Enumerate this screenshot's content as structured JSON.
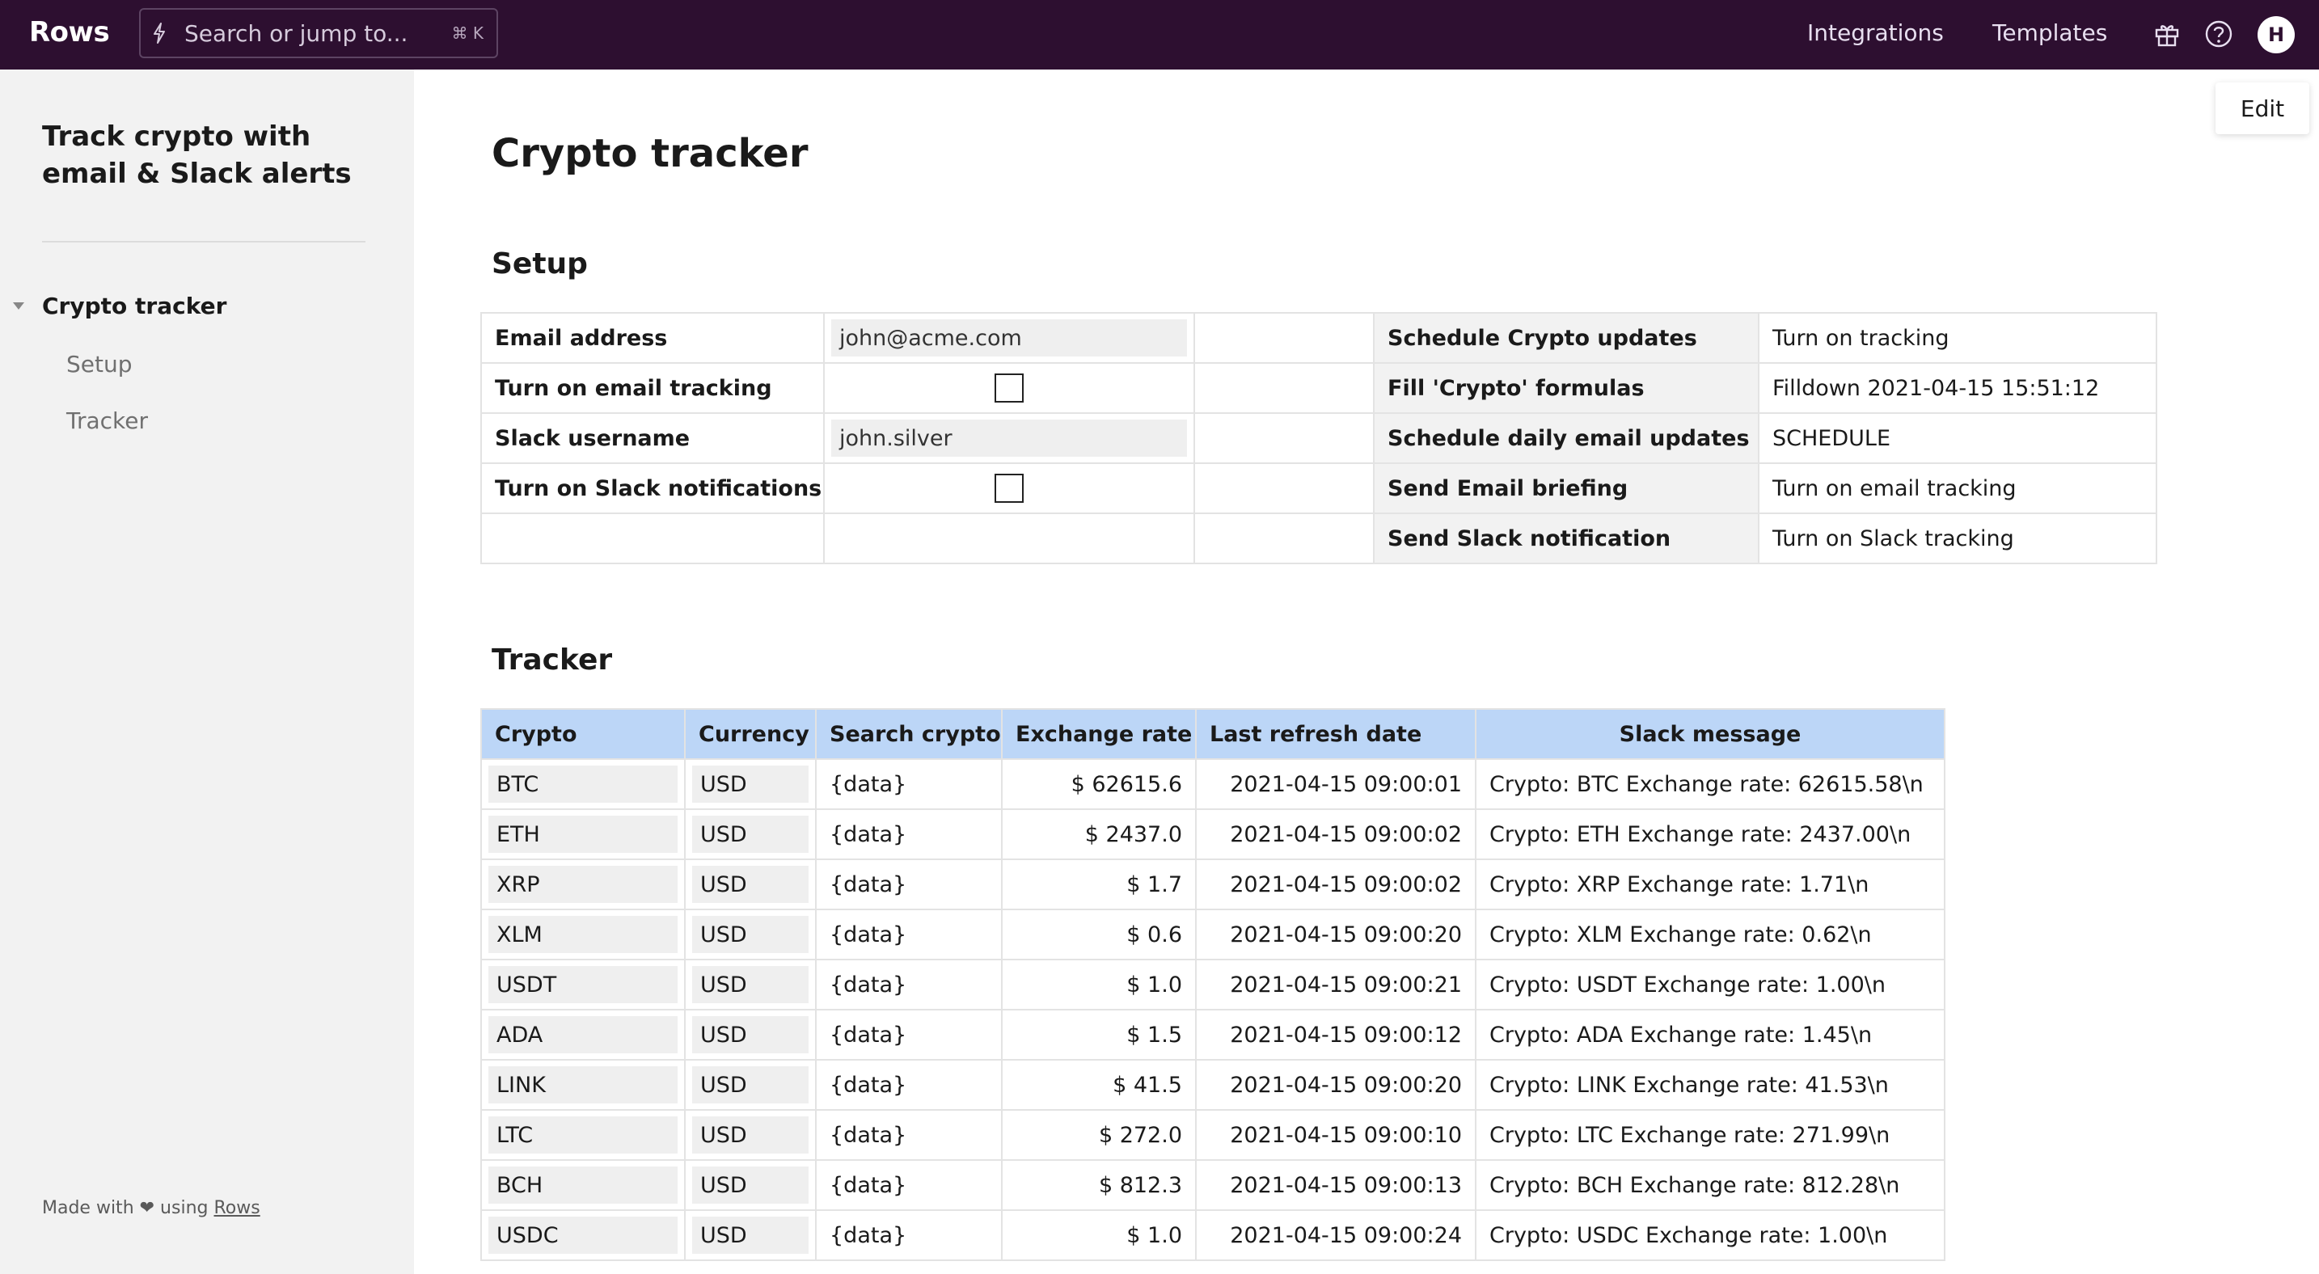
{
  "app": {
    "logo": "Rows",
    "search_placeholder": "Search or jump to...",
    "search_shortcut": "⌘ K",
    "nav": [
      "Integrations",
      "Templates"
    ],
    "avatar_initial": "H",
    "edit_label": "Edit"
  },
  "sidebar": {
    "title": "Track crypto with email & Slack alerts",
    "items": [
      {
        "label": "Crypto tracker",
        "level": 0,
        "active": true
      },
      {
        "label": "Setup",
        "level": 1
      },
      {
        "label": "Tracker",
        "level": 1
      }
    ],
    "footer_prefix": "Made with ❤ using",
    "footer_link": "Rows"
  },
  "page": {
    "title": "Crypto tracker",
    "setup_heading": "Setup",
    "tracker_heading": "Tracker"
  },
  "setup": {
    "rows": [
      {
        "label": "Email address",
        "value": "john@acme.com",
        "type": "text",
        "action": "Schedule Crypto updates",
        "action_value": "Turn on tracking"
      },
      {
        "label": "Turn on email tracking",
        "value": "",
        "type": "checkbox",
        "checked": false,
        "action": "Fill 'Crypto' formulas",
        "action_value": "Filldown 2021-04-15 15:51:12"
      },
      {
        "label": "Slack username",
        "value": "john.silver",
        "type": "text",
        "action": "Schedule daily email updates",
        "action_value": "SCHEDULE"
      },
      {
        "label": "Turn on Slack notifications",
        "value": "",
        "type": "checkbox",
        "checked": false,
        "action": "Send Email briefing",
        "action_value": "Turn on email tracking"
      },
      {
        "label": "",
        "value": "",
        "type": "empty",
        "action": "Send Slack notification",
        "action_value": "Turn on Slack tracking"
      }
    ]
  },
  "tracker": {
    "headers": [
      "Crypto",
      "Currency",
      "Search crypto",
      "Exchange rate",
      "Last refresh date",
      "Slack message"
    ],
    "rows": [
      {
        "crypto": "BTC",
        "currency": "USD",
        "search": "{data}",
        "rate": "$ 62615.6",
        "date": "2021-04-15 09:00:01",
        "message": "Crypto: BTC Exchange rate: 62615.58\\n"
      },
      {
        "crypto": "ETH",
        "currency": "USD",
        "search": "{data}",
        "rate": "$ 2437.0",
        "date": "2021-04-15 09:00:02",
        "message": "Crypto: ETH Exchange rate: 2437.00\\n"
      },
      {
        "crypto": "XRP",
        "currency": "USD",
        "search": "{data}",
        "rate": "$ 1.7",
        "date": "2021-04-15 09:00:02",
        "message": "Crypto: XRP Exchange rate: 1.71\\n"
      },
      {
        "crypto": "XLM",
        "currency": "USD",
        "search": "{data}",
        "rate": "$ 0.6",
        "date": "2021-04-15 09:00:20",
        "message": "Crypto: XLM Exchange rate: 0.62\\n"
      },
      {
        "crypto": "USDT",
        "currency": "USD",
        "search": "{data}",
        "rate": "$ 1.0",
        "date": "2021-04-15 09:00:21",
        "message": "Crypto: USDT Exchange rate: 1.00\\n"
      },
      {
        "crypto": "ADA",
        "currency": "USD",
        "search": "{data}",
        "rate": "$ 1.5",
        "date": "2021-04-15 09:00:12",
        "message": "Crypto: ADA Exchange rate: 1.45\\n"
      },
      {
        "crypto": "LINK",
        "currency": "USD",
        "search": "{data}",
        "rate": "$ 41.5",
        "date": "2021-04-15 09:00:20",
        "message": "Crypto: LINK Exchange rate: 41.53\\n"
      },
      {
        "crypto": "LTC",
        "currency": "USD",
        "search": "{data}",
        "rate": "$ 272.0",
        "date": "2021-04-15 09:00:10",
        "message": "Crypto: LTC Exchange rate: 271.99\\n"
      },
      {
        "crypto": "BCH",
        "currency": "USD",
        "search": "{data}",
        "rate": "$ 812.3",
        "date": "2021-04-15 09:00:13",
        "message": "Crypto: BCH Exchange rate: 812.28\\n"
      },
      {
        "crypto": "USDC",
        "currency": "USD",
        "search": "{data}",
        "rate": "$ 1.0",
        "date": "2021-04-15 09:00:24",
        "message": "Crypto: USDC Exchange rate: 1.00\\n"
      }
    ]
  }
}
